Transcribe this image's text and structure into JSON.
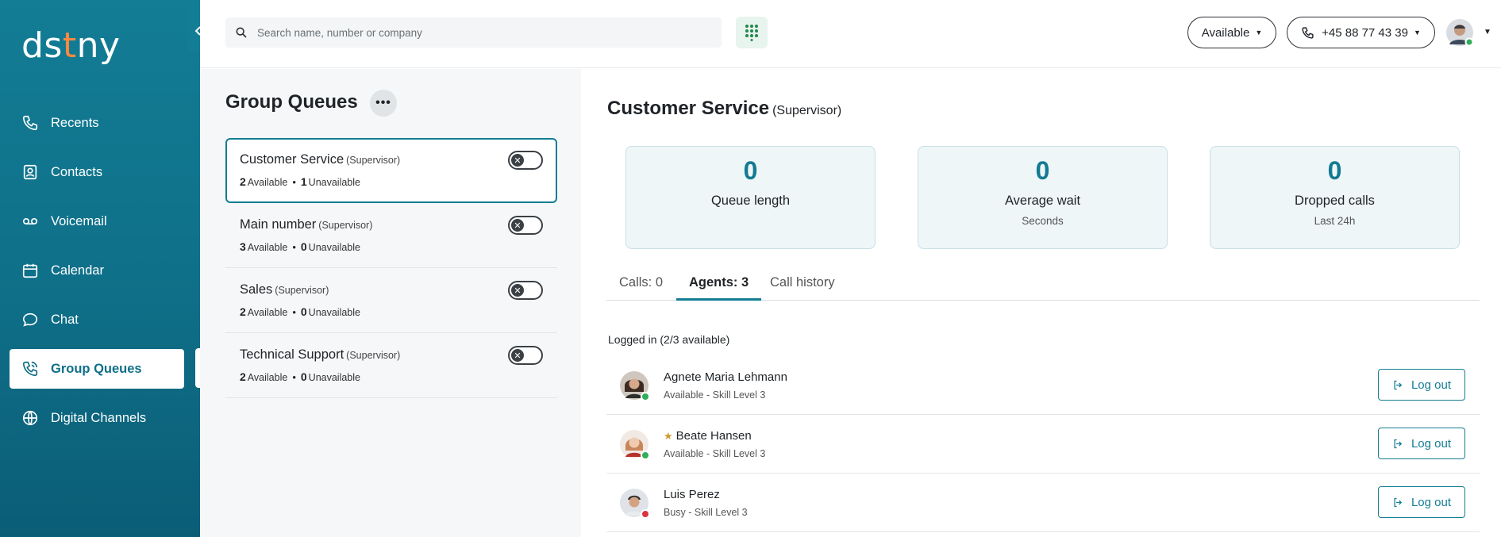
{
  "brand": {
    "logo_pre": "ds",
    "logo_dot": "t",
    "logo_post": "ny",
    "accent": "#127d95",
    "logo_dot_color": "#ff8a3d"
  },
  "sidebar": {
    "items": [
      {
        "label": "Recents",
        "icon": "phone-icon"
      },
      {
        "label": "Contacts",
        "icon": "contact-card-icon"
      },
      {
        "label": "Voicemail",
        "icon": "voicemail-icon"
      },
      {
        "label": "Calendar",
        "icon": "calendar-icon"
      },
      {
        "label": "Chat",
        "icon": "chat-bubble-icon"
      },
      {
        "label": "Group Queues",
        "icon": "group-phone-icon",
        "active": true
      },
      {
        "label": "Digital Channels",
        "icon": "globe-icon"
      }
    ]
  },
  "topbar": {
    "search_placeholder": "Search name, number or company",
    "status_label": "Available",
    "phone_number": "+45 88 77 43 39"
  },
  "queues": {
    "title": "Group Queues",
    "items": [
      {
        "name": "Customer Service",
        "role": "(Supervisor)",
        "available": "2",
        "available_label": "Available",
        "unavailable": "1",
        "unavailable_label": "Unavailable",
        "selected": true
      },
      {
        "name": "Main number",
        "role": "(Supervisor)",
        "available": "3",
        "available_label": "Available",
        "unavailable": "0",
        "unavailable_label": "Unavailable"
      },
      {
        "name": "Sales",
        "role": "(Supervisor)",
        "available": "2",
        "available_label": "Available",
        "unavailable": "0",
        "unavailable_label": "Unavailable"
      },
      {
        "name": "Technical Support",
        "role": "(Supervisor)",
        "available": "2",
        "available_label": "Available",
        "unavailable": "0",
        "unavailable_label": "Unavailable"
      }
    ]
  },
  "detail": {
    "title": "Customer Service",
    "role": "(Supervisor)",
    "stats": [
      {
        "value": "0",
        "label": "Queue length",
        "sub": ""
      },
      {
        "value": "0",
        "label": "Average wait",
        "sub": "Seconds"
      },
      {
        "value": "0",
        "label": "Dropped calls",
        "sub": "Last 24h"
      }
    ],
    "tabs": [
      {
        "label": "Calls: 0"
      },
      {
        "label": "Agents: 3",
        "active": true
      },
      {
        "label": "Call history"
      }
    ],
    "logged_in_label": "Logged in (2/3 available)",
    "agents": [
      {
        "name": "Agnete Maria Lehmann",
        "status": "Available - Skill Level 3",
        "presence_color": "#2fae5b",
        "starred": false
      },
      {
        "name": "Beate Hansen",
        "status": "Available - Skill Level 3",
        "presence_color": "#2fae5b",
        "starred": true
      },
      {
        "name": "Luis Perez",
        "status": "Busy - Skill Level 3",
        "presence_color": "#d9363e",
        "starred": false
      }
    ],
    "logout_label": "Log out"
  }
}
